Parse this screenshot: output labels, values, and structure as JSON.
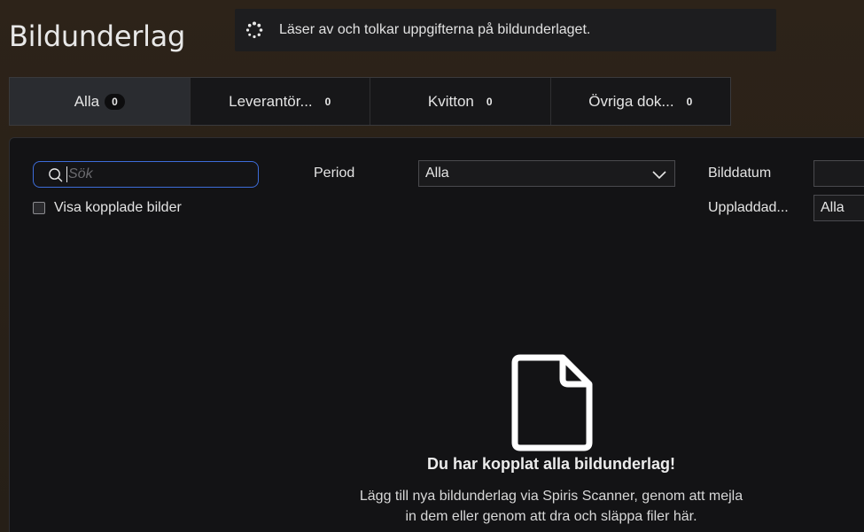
{
  "header": {
    "title": "Bildunderlag"
  },
  "toast": {
    "text": "Läser av och tolkar uppgifterna på bildunderlaget."
  },
  "tabs": [
    {
      "label": "Alla",
      "count": "0"
    },
    {
      "label": "Leverantör...",
      "count": "0"
    },
    {
      "label": "Kvitton",
      "count": "0"
    },
    {
      "label": "Övriga dok...",
      "count": "0"
    }
  ],
  "filters": {
    "search_placeholder": "Sök",
    "show_linked_label": "Visa kopplade bilder",
    "period_label": "Period",
    "period_value": "Alla",
    "image_date_label": "Bilddatum",
    "image_date_value": "",
    "uploaded_label": "Uppladdad...",
    "uploaded_value": "Alla"
  },
  "empty_state": {
    "title": "Du har kopplat alla bildunderlag!",
    "description": "Lägg till nya bildunderlag via Spiris Scanner, genom att mejla in dem eller genom att dra och släppa filer här."
  }
}
